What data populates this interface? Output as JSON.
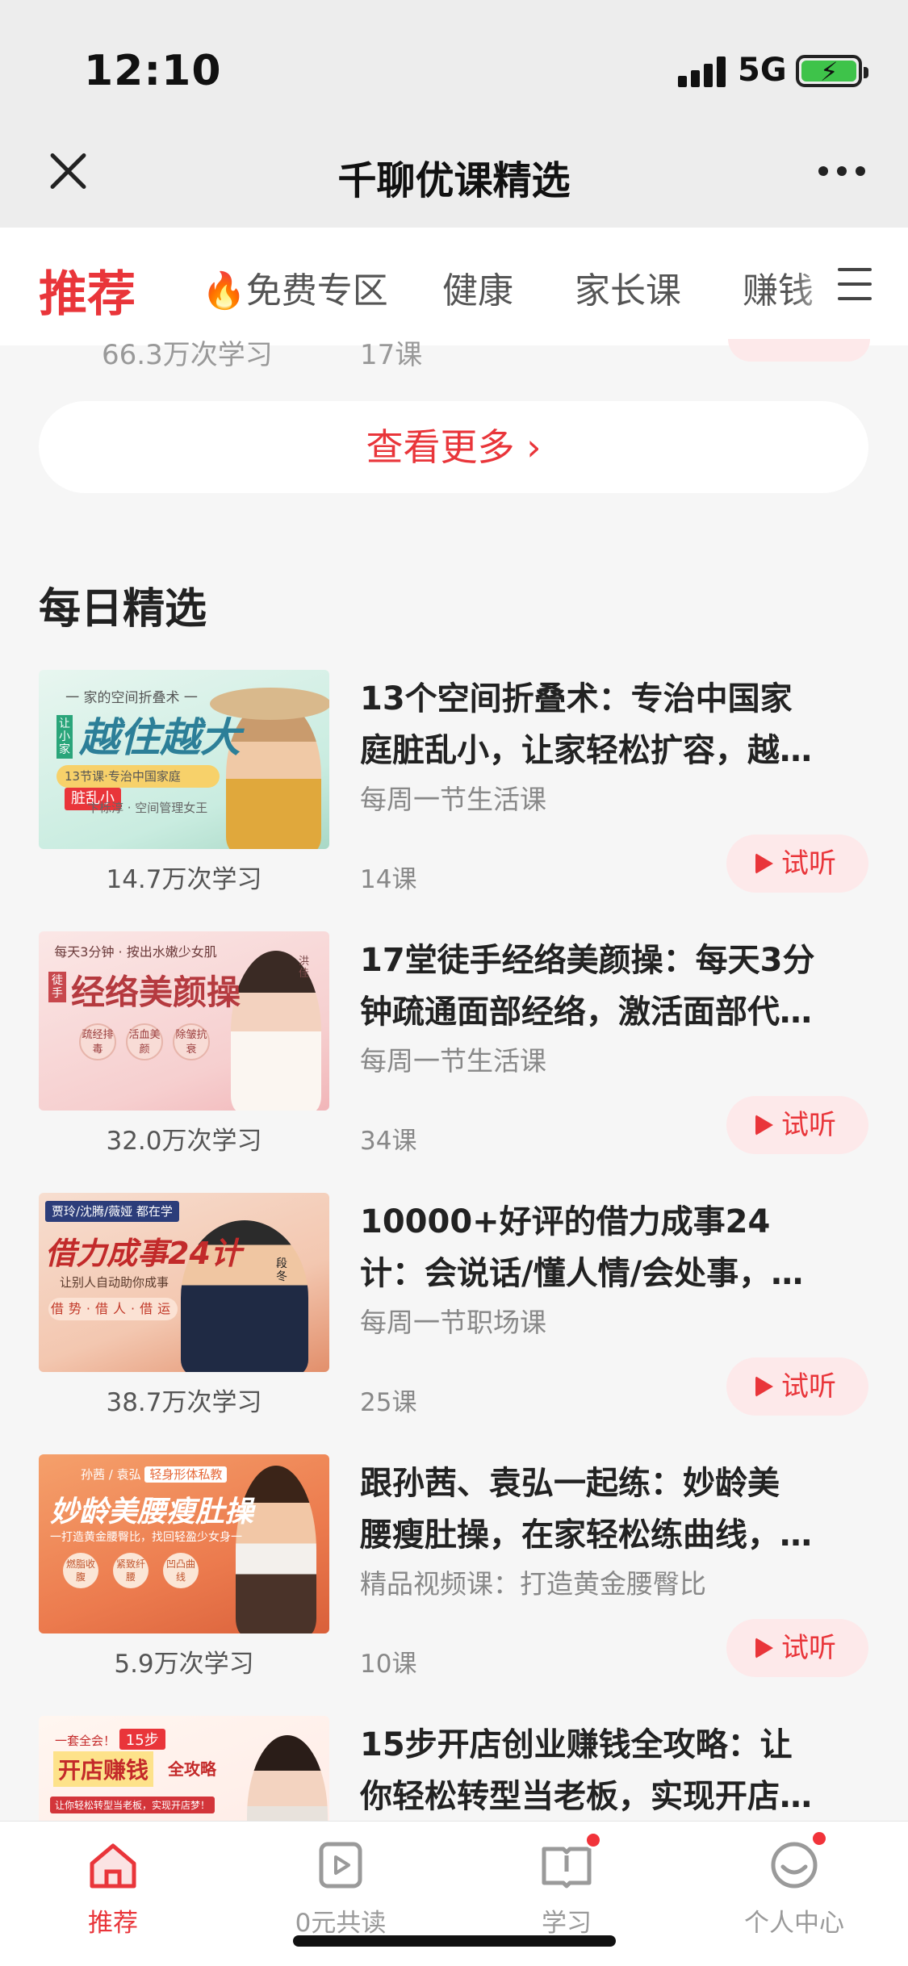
{
  "status_bar": {
    "time": "12:10",
    "network": "5G"
  },
  "nav": {
    "title": "千聊优课精选",
    "close_icon": "close-icon",
    "more_icon": "more-dots-icon"
  },
  "tabs": [
    {
      "label": "推荐",
      "active": true
    },
    {
      "label": "🔥免费专区"
    },
    {
      "label": "健康"
    },
    {
      "label": "家长课"
    },
    {
      "label": "赚钱"
    }
  ],
  "prev_row_cut": {
    "learners": "66.3万次学习",
    "count": "17课"
  },
  "see_more": "查看更多 ›",
  "section_title": "每日精选",
  "courses": [
    {
      "title_l1": "13个空间折叠术：专治中国家",
      "title_l2": "庭脏乱小，让家轻松扩容，越…",
      "subtitle": "每周一节生活课",
      "learners": "14.7万次学习",
      "count": "14课",
      "trial": "试听",
      "thumb": {
        "kicker": "一 家的空间折叠术 一",
        "headline": "越住越大",
        "badge": "让小家",
        "tagline": "13节课·专治中国家庭",
        "tag": "脏乱小",
        "author": "卞栎淳 · 空间管理女王"
      }
    },
    {
      "title_l1": "17堂徒手经络美颜操：每天3分",
      "title_l2": "钟疏通面部经络，激活面部代…",
      "subtitle": "每周一节生活课",
      "learners": "32.0万次学习",
      "count": "34课",
      "trial": "试听",
      "thumb": {
        "kicker": "每天3分钟 · 按出水嫩少女肌",
        "headline": "经络美颜操",
        "badge": "徒手",
        "chips": [
          "疏经排毒",
          "活血美颜",
          "除皱抗衰"
        ],
        "author": "洪佳"
      }
    },
    {
      "title_l1": "10000+好评的借力成事24",
      "title_l2": "计：会说话/懂人情/会处事，…",
      "subtitle": "每周一节职场课",
      "learners": "38.7万次学习",
      "count": "25课",
      "trial": "试听",
      "thumb": {
        "kicker": "贾玲/沈腾/薇娅 都在学",
        "headline": "借力成事24计",
        "tagline": "让别人自动助你成事",
        "chips": [
          "借势",
          "借人",
          "借运"
        ],
        "author": "段冬"
      }
    },
    {
      "title_l1": "跟孙茜、袁弘一起练：妙龄美",
      "title_l2": "腰瘦肚操，在家轻松练曲线，…",
      "subtitle": "精品视频课：打造黄金腰臀比",
      "learners": "5.9万次学习",
      "count": "10课",
      "trial": "试听",
      "thumb": {
        "kicker": "孙茜 / 袁弘",
        "badge": "轻身形体私教",
        "headline": "妙龄美腰瘦肚操",
        "tagline": "一打造黄金腰臀比，找回轻盈少女身一",
        "chips": [
          "燃脂收腹",
          "紧致纤腰",
          "凹凸曲线"
        ]
      }
    },
    {
      "title_l1": "15步开店创业赚钱全攻略：让",
      "title_l2": "你轻松转型当老板，实现开店…",
      "thumb": {
        "kicker": "一套全会！",
        "badge": "15步",
        "headline": "开店赚钱",
        "tag": "全攻略",
        "tagline": "让你轻松转型当老板，实现开店梦！"
      }
    }
  ],
  "bottom_nav": [
    {
      "label": "推荐",
      "icon": "home-icon",
      "active": true
    },
    {
      "label": "0元共读",
      "icon": "video-play-icon"
    },
    {
      "label": "学习",
      "icon": "book-icon",
      "badge": true
    },
    {
      "label": "个人中心",
      "icon": "profile-face-icon",
      "badge": true
    }
  ],
  "colors": {
    "accent": "#e9353a",
    "trial_bg": "#fde9ea",
    "page_bg": "#f6f6f6",
    "battery": "#3ec34a"
  }
}
